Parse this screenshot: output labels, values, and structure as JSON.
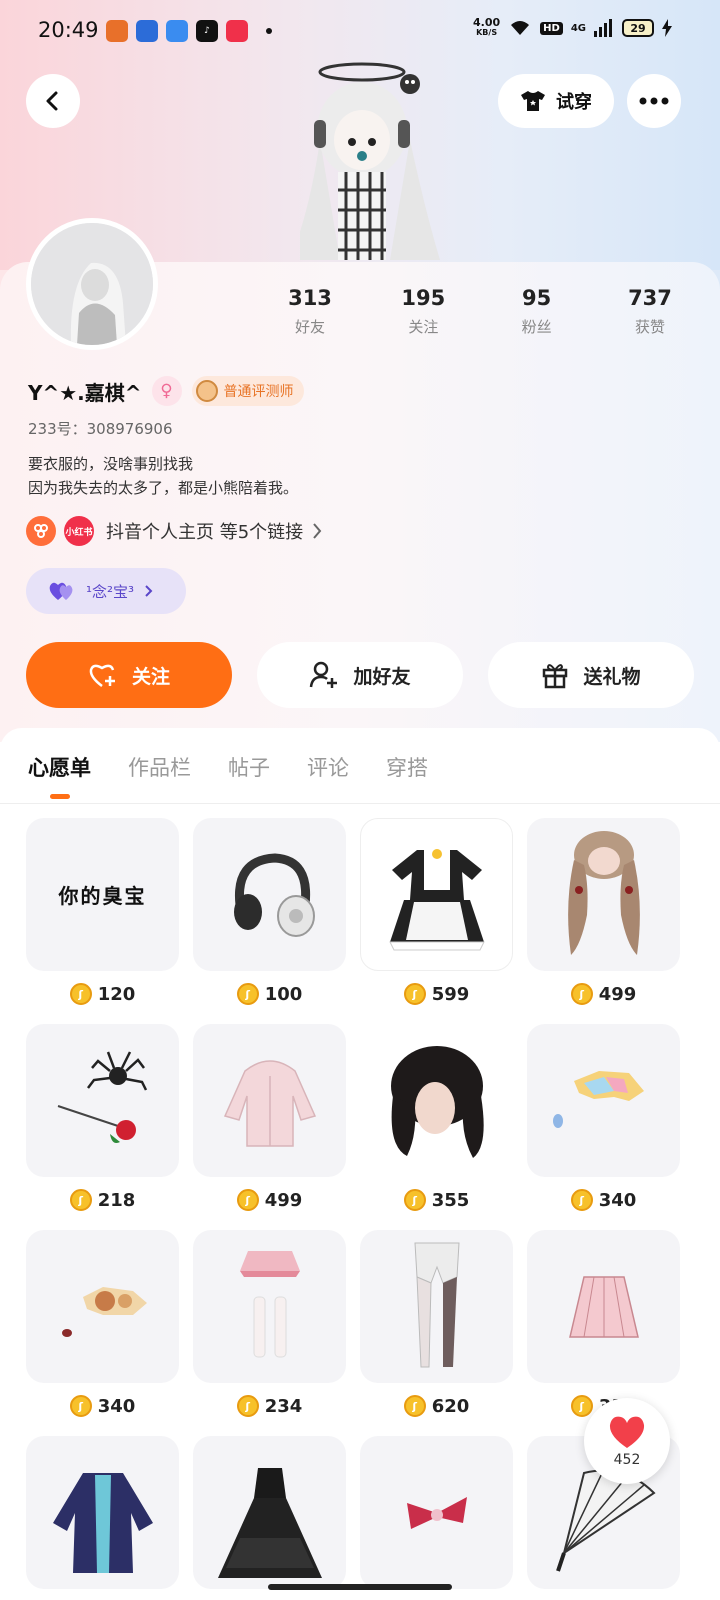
{
  "status": {
    "time": "20:49",
    "net_speed_top": "4.00",
    "net_speed_unit": "KB/S",
    "hd": "HD",
    "network": "4G",
    "battery": "29"
  },
  "header": {
    "try_on_label": "试穿"
  },
  "profile": {
    "stats": [
      {
        "value": "313",
        "label": "好友"
      },
      {
        "value": "195",
        "label": "关注"
      },
      {
        "value": "95",
        "label": "粉丝"
      },
      {
        "value": "737",
        "label": "获赞"
      }
    ],
    "name": "Y^★.嘉棋^",
    "gender_symbol": "♀",
    "badge_label": "普通评测师",
    "uid": "233号：308976906",
    "bio_line1": "要衣服的，没啥事别找我",
    "bio_line2": "因为我失去的太多了，都是小熊陪着我。",
    "links_text": "抖音个人主页 等5个链接",
    "link_icon_text": "小红书",
    "pill_label": "¹念²宝³"
  },
  "actions": {
    "follow": "关注",
    "add_friend": "加好友",
    "send_gift": "送礼物"
  },
  "tabs": [
    "心愿单",
    "作品栏",
    "帖子",
    "评论",
    "穿搭"
  ],
  "wishlist": [
    {
      "price": "120",
      "thumb_text": "你的臭宝"
    },
    {
      "price": "100"
    },
    {
      "price": "599"
    },
    {
      "price": "499"
    },
    {
      "price": "218"
    },
    {
      "price": "499"
    },
    {
      "price": "355"
    },
    {
      "price": "340"
    },
    {
      "price": "340"
    },
    {
      "price": "234"
    },
    {
      "price": "620"
    },
    {
      "price": "330"
    },
    {
      "price": ""
    },
    {
      "price": ""
    },
    {
      "price": ""
    },
    {
      "price": ""
    }
  ],
  "favorite": {
    "count": "452"
  },
  "colors": {
    "accent": "#ff6e14",
    "pill": "#5a46c9"
  }
}
